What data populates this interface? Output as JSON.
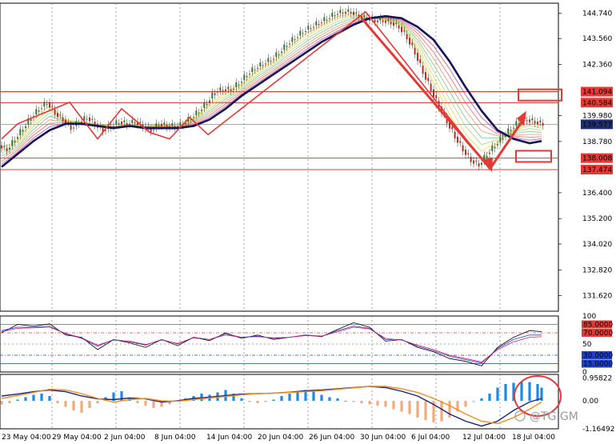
{
  "colors": {
    "background": "#ffffff",
    "bull": "#2e7d32",
    "bear": "#c62828",
    "ma_main": "#14145a",
    "hline_red": "#e53935",
    "hline_blue": "#7986cb",
    "current_price_bg": "#1f2f6f",
    "macd_pos": "#1e88e5",
    "macd_neg": "#f4a97a",
    "macd_signal": "#f08c1a",
    "macd_line": "#1a237e",
    "rsi_1": "#000000",
    "rsi_2": "#1e40c8",
    "rsi_3": "#d81b60"
  },
  "watermark": "@TG GM",
  "chart_data": [
    {
      "type": "line",
      "panel": "price",
      "title": "",
      "ylim": [
        130.9,
        145.2
      ],
      "y_ticks": [
        "144.740",
        "143.560",
        "142.360",
        "141.094",
        "140.584",
        "139.980",
        "139.577",
        "138.780",
        "138.008",
        "137.474",
        "136.400",
        "135.200",
        "134.020",
        "132.820",
        "131.620"
      ],
      "highlighted_ticks": [
        "141.094",
        "140.584",
        "139.577",
        "138.008",
        "137.474"
      ],
      "current_price": 139.577,
      "resistance_levels": [
        141.094,
        140.584
      ],
      "support_levels": [
        138.008,
        137.474
      ],
      "x_labels": [
        "23 May 04:00",
        "29 May 04:00",
        "2 Jun 04:00",
        "8 Jun 04:00",
        "14 Jun 04:00",
        "20 Jun 04:00",
        "26 Jun 04:00",
        "30 Jun 04:00",
        "6 Jul 04:00",
        "12 Jul 04:00",
        "18 Jul 04:00"
      ],
      "grid": true,
      "series": [
        {
          "x": [
            0,
            10,
            20,
            30,
            40,
            50,
            60,
            70,
            80,
            90,
            100,
            110,
            120,
            130,
            140,
            150,
            160,
            170,
            180,
            190,
            200,
            210,
            220,
            230,
            240,
            250,
            260,
            270,
            280,
            290,
            300,
            310,
            320,
            330,
            340,
            350,
            360,
            370,
            380,
            390,
            400,
            410,
            420,
            430,
            440,
            450,
            460,
            470,
            480,
            490,
            500,
            510,
            520,
            530,
            540,
            550,
            560,
            570,
            580,
            590,
            600,
            610,
            620,
            630,
            640,
            650,
            660,
            670,
            675
          ],
          "values": [
            138.6,
            138.4,
            138.9,
            139.4,
            139.9,
            140.3,
            140.6,
            140.1,
            139.8,
            139.4,
            139.7,
            139.9,
            139.6,
            139.3,
            139.5,
            139.7,
            139.6,
            139.7,
            139.5,
            139.3,
            139.6,
            139.5,
            139.5,
            139.6,
            139.9,
            140.2,
            140.6,
            141.1,
            141.2,
            141.2,
            141.5,
            141.9,
            142.2,
            142.4,
            142.6,
            142.9,
            143.3,
            143.6,
            143.9,
            144.1,
            144.3,
            144.5,
            144.7,
            144.8,
            144.8,
            144.6,
            144.5,
            144.4,
            144.4,
            144.3,
            144.1,
            143.6,
            142.9,
            142.0,
            141.2,
            140.4,
            139.7,
            139.0,
            138.4,
            137.9,
            137.7,
            138.2,
            138.6,
            139.0,
            139.4,
            139.7,
            139.8,
            139.7,
            139.6
          ]
        },
        {
          "name": "",
          "x": [
            0,
            20,
            40,
            60,
            80,
            100,
            120,
            140,
            160,
            180,
            200,
            220,
            240,
            260,
            280,
            300,
            320,
            340,
            360,
            380,
            400,
            420,
            440,
            460,
            480,
            500,
            520,
            540,
            560,
            580,
            600,
            620,
            640,
            660,
            675
          ],
          "values": [
            137.6,
            138.2,
            138.8,
            139.3,
            139.6,
            139.6,
            139.5,
            139.4,
            139.5,
            139.4,
            139.4,
            139.4,
            139.5,
            139.8,
            140.3,
            140.9,
            141.4,
            141.9,
            142.4,
            142.9,
            143.4,
            143.8,
            144.2,
            144.5,
            144.6,
            144.5,
            144.1,
            143.5,
            142.5,
            141.3,
            140.2,
            139.3,
            138.9,
            138.7,
            138.8
          ]
        }
      ]
    },
    {
      "type": "line",
      "panel": "rsi",
      "ylim": [
        0,
        100
      ],
      "y_ticks": [
        "100",
        "85.0000",
        "70.0000",
        "50",
        "30.0000",
        "15.0000",
        "0"
      ],
      "levels": [
        85,
        70,
        50,
        30,
        15
      ],
      "series": [
        {
          "x": [
            0,
            20,
            40,
            60,
            80,
            100,
            120,
            140,
            160,
            180,
            200,
            220,
            240,
            260,
            280,
            300,
            320,
            340,
            360,
            380,
            400,
            420,
            440,
            460,
            480,
            500,
            520,
            540,
            560,
            580,
            600,
            620,
            640,
            660,
            675
          ],
          "values": [
            70,
            85,
            82,
            86,
            66,
            62,
            40,
            58,
            52,
            44,
            58,
            47,
            62,
            56,
            70,
            60,
            66,
            58,
            62,
            66,
            63,
            76,
            88,
            80,
            55,
            58,
            44,
            36,
            24,
            19,
            11,
            44,
            62,
            74,
            72
          ]
        },
        {
          "x": [
            0,
            20,
            40,
            60,
            80,
            100,
            120,
            140,
            160,
            180,
            200,
            220,
            240,
            260,
            280,
            300,
            320,
            340,
            360,
            380,
            400,
            420,
            440,
            460,
            480,
            500,
            520,
            540,
            560,
            580,
            600,
            620,
            640,
            660,
            675
          ],
          "values": [
            74,
            80,
            80,
            82,
            68,
            60,
            46,
            58,
            54,
            48,
            58,
            50,
            62,
            58,
            68,
            62,
            64,
            60,
            62,
            66,
            64,
            74,
            82,
            78,
            58,
            58,
            46,
            38,
            28,
            22,
            16,
            42,
            58,
            66,
            66
          ]
        },
        {
          "x": [
            0,
            20,
            40,
            60,
            80,
            100,
            120,
            140,
            160,
            180,
            200,
            220,
            240,
            260,
            280,
            300,
            320,
            340,
            360,
            380,
            400,
            420,
            440,
            460,
            480,
            500,
            520,
            540,
            560,
            580,
            600,
            620,
            640,
            660,
            675
          ],
          "values": [
            72,
            78,
            79,
            80,
            69,
            61,
            48,
            57,
            55,
            49,
            57,
            51,
            61,
            58,
            66,
            62,
            63,
            61,
            62,
            65,
            64,
            72,
            80,
            77,
            60,
            57,
            48,
            40,
            30,
            24,
            18,
            40,
            54,
            62,
            63
          ]
        }
      ]
    },
    {
      "type": "bar",
      "panel": "macd",
      "ylim": [
        -1.1649,
        1.1
      ],
      "y_ticks": [
        "0.95822",
        "0.00",
        "-1.16492"
      ],
      "hist_x": [
        0,
        10,
        20,
        30,
        40,
        50,
        60,
        70,
        80,
        90,
        100,
        110,
        120,
        130,
        140,
        150,
        160,
        170,
        180,
        190,
        200,
        210,
        220,
        230,
        240,
        250,
        260,
        270,
        280,
        290,
        300,
        310,
        320,
        330,
        340,
        350,
        360,
        370,
        380,
        390,
        400,
        410,
        420,
        430,
        440,
        450,
        460,
        470,
        480,
        490,
        500,
        510,
        520,
        530,
        540,
        550,
        560,
        570,
        580,
        590,
        600,
        610,
        620,
        630,
        640,
        650,
        660,
        670,
        675
      ],
      "histogram": [
        -0.15,
        -0.1,
        0.05,
        0.15,
        0.25,
        0.3,
        0.2,
        -0.1,
        -0.25,
        -0.4,
        -0.5,
        -0.3,
        -0.1,
        0.15,
        0.35,
        0.4,
        0.1,
        -0.1,
        -0.2,
        -0.3,
        -0.25,
        -0.15,
        0.0,
        0.1,
        0.2,
        0.3,
        0.25,
        0.35,
        0.45,
        0.3,
        0.1,
        -0.05,
        -0.1,
        -0.05,
        0.05,
        0.2,
        0.3,
        0.35,
        0.45,
        0.4,
        0.25,
        0.15,
        0.1,
        0.0,
        -0.05,
        -0.1,
        -0.15,
        -0.2,
        -0.25,
        -0.35,
        -0.45,
        -0.55,
        -0.7,
        -0.8,
        -0.9,
        -0.85,
        -0.7,
        -0.45,
        -0.25,
        -0.05,
        0.1,
        0.3,
        0.55,
        0.7,
        0.75,
        0.8,
        0.78,
        0.7,
        0.55
      ],
      "series": [
        {
          "x": [
            0,
            20,
            40,
            60,
            80,
            100,
            120,
            140,
            160,
            180,
            200,
            220,
            240,
            260,
            280,
            300,
            320,
            340,
            360,
            380,
            400,
            420,
            440,
            460,
            480,
            500,
            520,
            540,
            560,
            580,
            600,
            620,
            640,
            660,
            675
          ],
          "values": [
            0.2,
            0.28,
            0.38,
            0.45,
            0.38,
            0.2,
            0.08,
            0.05,
            0.12,
            0.08,
            -0.05,
            0.0,
            0.1,
            0.15,
            0.22,
            0.28,
            0.3,
            0.32,
            0.36,
            0.42,
            0.45,
            0.5,
            0.55,
            0.6,
            0.55,
            0.4,
            0.2,
            -0.15,
            -0.55,
            -0.85,
            -1.05,
            -0.85,
            -0.4,
            -0.05,
            0.1
          ]
        },
        {
          "x": [
            0,
            20,
            40,
            60,
            80,
            100,
            120,
            140,
            160,
            180,
            200,
            220,
            240,
            260,
            280,
            300,
            320,
            340,
            360,
            380,
            400,
            420,
            440,
            460,
            480,
            500,
            520,
            540,
            560,
            580,
            600,
            620,
            640,
            660,
            675
          ],
          "values": [
            0.1,
            0.22,
            0.35,
            0.48,
            0.45,
            0.3,
            0.1,
            -0.05,
            0.05,
            0.1,
            0.0,
            -0.02,
            0.05,
            0.12,
            0.18,
            0.25,
            0.3,
            0.32,
            0.35,
            0.38,
            0.42,
            0.48,
            0.54,
            0.6,
            0.6,
            0.5,
            0.35,
            0.1,
            -0.2,
            -0.55,
            -0.85,
            -0.95,
            -0.7,
            -0.35,
            -0.05
          ]
        }
      ]
    }
  ]
}
